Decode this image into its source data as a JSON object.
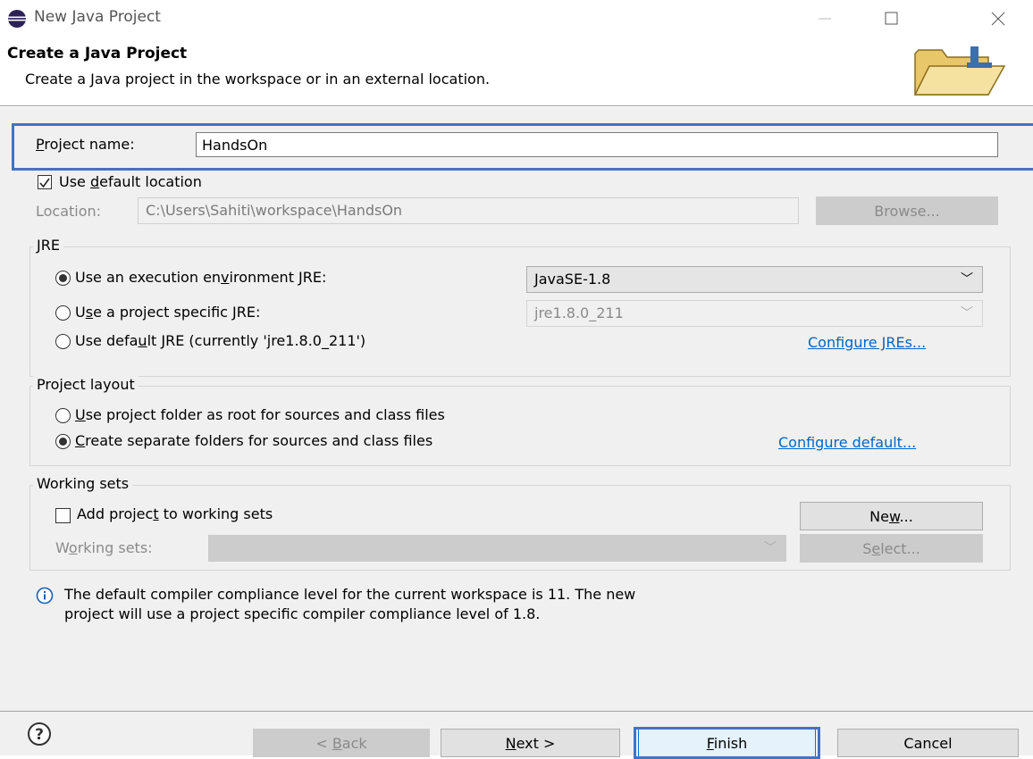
{
  "window": {
    "title": "New Java Project"
  },
  "header": {
    "title": "Create a Java Project",
    "subtitle": "Create a Java project in the workspace or in an external location."
  },
  "project_name": {
    "label_pre": "",
    "label_mnemonic": "P",
    "label_post": "roject name:",
    "value": "HandsOn"
  },
  "default_location": {
    "label_pre": "Use ",
    "label_mnemonic": "d",
    "label_post": "efault location",
    "checked": true
  },
  "location": {
    "label": "Location:",
    "value": "C:\\Users\\Sahiti\\workspace\\HandsOn",
    "browse_label": "Browse..."
  },
  "jre": {
    "group_title": "JRE",
    "opt1_pre": "Use an execution en",
    "opt1_mn": "v",
    "opt1_post": "ironment JRE:",
    "opt1_combo": "JavaSE-1.8",
    "opt2_pre": "U",
    "opt2_mn": "s",
    "opt2_post": "e a project specific JRE:",
    "opt2_combo": "jre1.8.0_211",
    "opt3_pre": "Use defa",
    "opt3_mn": "u",
    "opt3_post": "lt JRE (currently 'jre1.8.0_211')",
    "configure_link": "Configure JREs..."
  },
  "layout": {
    "group_title": "Project layout",
    "opt1_pre": "",
    "opt1_mn": "U",
    "opt1_post": "se project folder as root for sources and class files",
    "opt2_pre": "",
    "opt2_mn": "C",
    "opt2_post": "reate separate folders for sources and class files",
    "configure_link": "Configure default..."
  },
  "working_sets": {
    "group_title": "Working sets",
    "add_pre": "Add projec",
    "add_mn": "t",
    "add_post": " to working sets",
    "new_pre": "Ne",
    "new_mn": "w",
    "new_post": "...",
    "label_pre": "W",
    "label_mn": "o",
    "label_post": "rking sets:",
    "select_pre": "S",
    "select_mn": "e",
    "select_post": "lect..."
  },
  "info": {
    "line1": "The default compiler compliance level for the current workspace is 11. The new",
    "line2": "project will use a project specific compiler compliance level of 1.8."
  },
  "footer": {
    "back_pre": "< ",
    "back_mn": "B",
    "back_post": "ack",
    "next_pre": "",
    "next_mn": "N",
    "next_post": "ext >",
    "finish_pre": "",
    "finish_mn": "F",
    "finish_post": "inish",
    "cancel_label": "Cancel"
  },
  "colors": {
    "highlight": "#4472c4",
    "link": "#0066cc"
  }
}
